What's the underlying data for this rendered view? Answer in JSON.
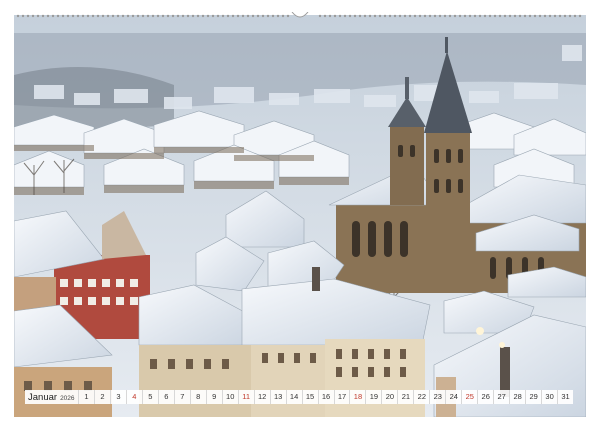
{
  "calendar": {
    "month": "Januar",
    "year": "2026",
    "days": [
      {
        "n": "1",
        "sunday": false
      },
      {
        "n": "2",
        "sunday": false
      },
      {
        "n": "3",
        "sunday": false
      },
      {
        "n": "4",
        "sunday": true
      },
      {
        "n": "5",
        "sunday": false
      },
      {
        "n": "6",
        "sunday": false
      },
      {
        "n": "7",
        "sunday": false
      },
      {
        "n": "8",
        "sunday": false
      },
      {
        "n": "9",
        "sunday": false
      },
      {
        "n": "10",
        "sunday": false
      },
      {
        "n": "11",
        "sunday": true
      },
      {
        "n": "12",
        "sunday": false
      },
      {
        "n": "13",
        "sunday": false
      },
      {
        "n": "14",
        "sunday": false
      },
      {
        "n": "15",
        "sunday": false
      },
      {
        "n": "16",
        "sunday": false
      },
      {
        "n": "17",
        "sunday": false
      },
      {
        "n": "18",
        "sunday": true
      },
      {
        "n": "19",
        "sunday": false
      },
      {
        "n": "20",
        "sunday": false
      },
      {
        "n": "21",
        "sunday": false
      },
      {
        "n": "22",
        "sunday": false
      },
      {
        "n": "23",
        "sunday": false
      },
      {
        "n": "24",
        "sunday": false
      },
      {
        "n": "25",
        "sunday": true
      },
      {
        "n": "26",
        "sunday": false
      },
      {
        "n": "27",
        "sunday": false
      },
      {
        "n": "28",
        "sunday": false
      },
      {
        "n": "29",
        "sunday": false
      },
      {
        "n": "30",
        "sunday": false
      },
      {
        "n": "31",
        "sunday": false
      }
    ]
  },
  "colors": {
    "sunday": "#c0392b",
    "weekday": "#333333",
    "snow": "#eef2f7",
    "stone": "#8a7355",
    "sky": "#cfd9e3"
  }
}
